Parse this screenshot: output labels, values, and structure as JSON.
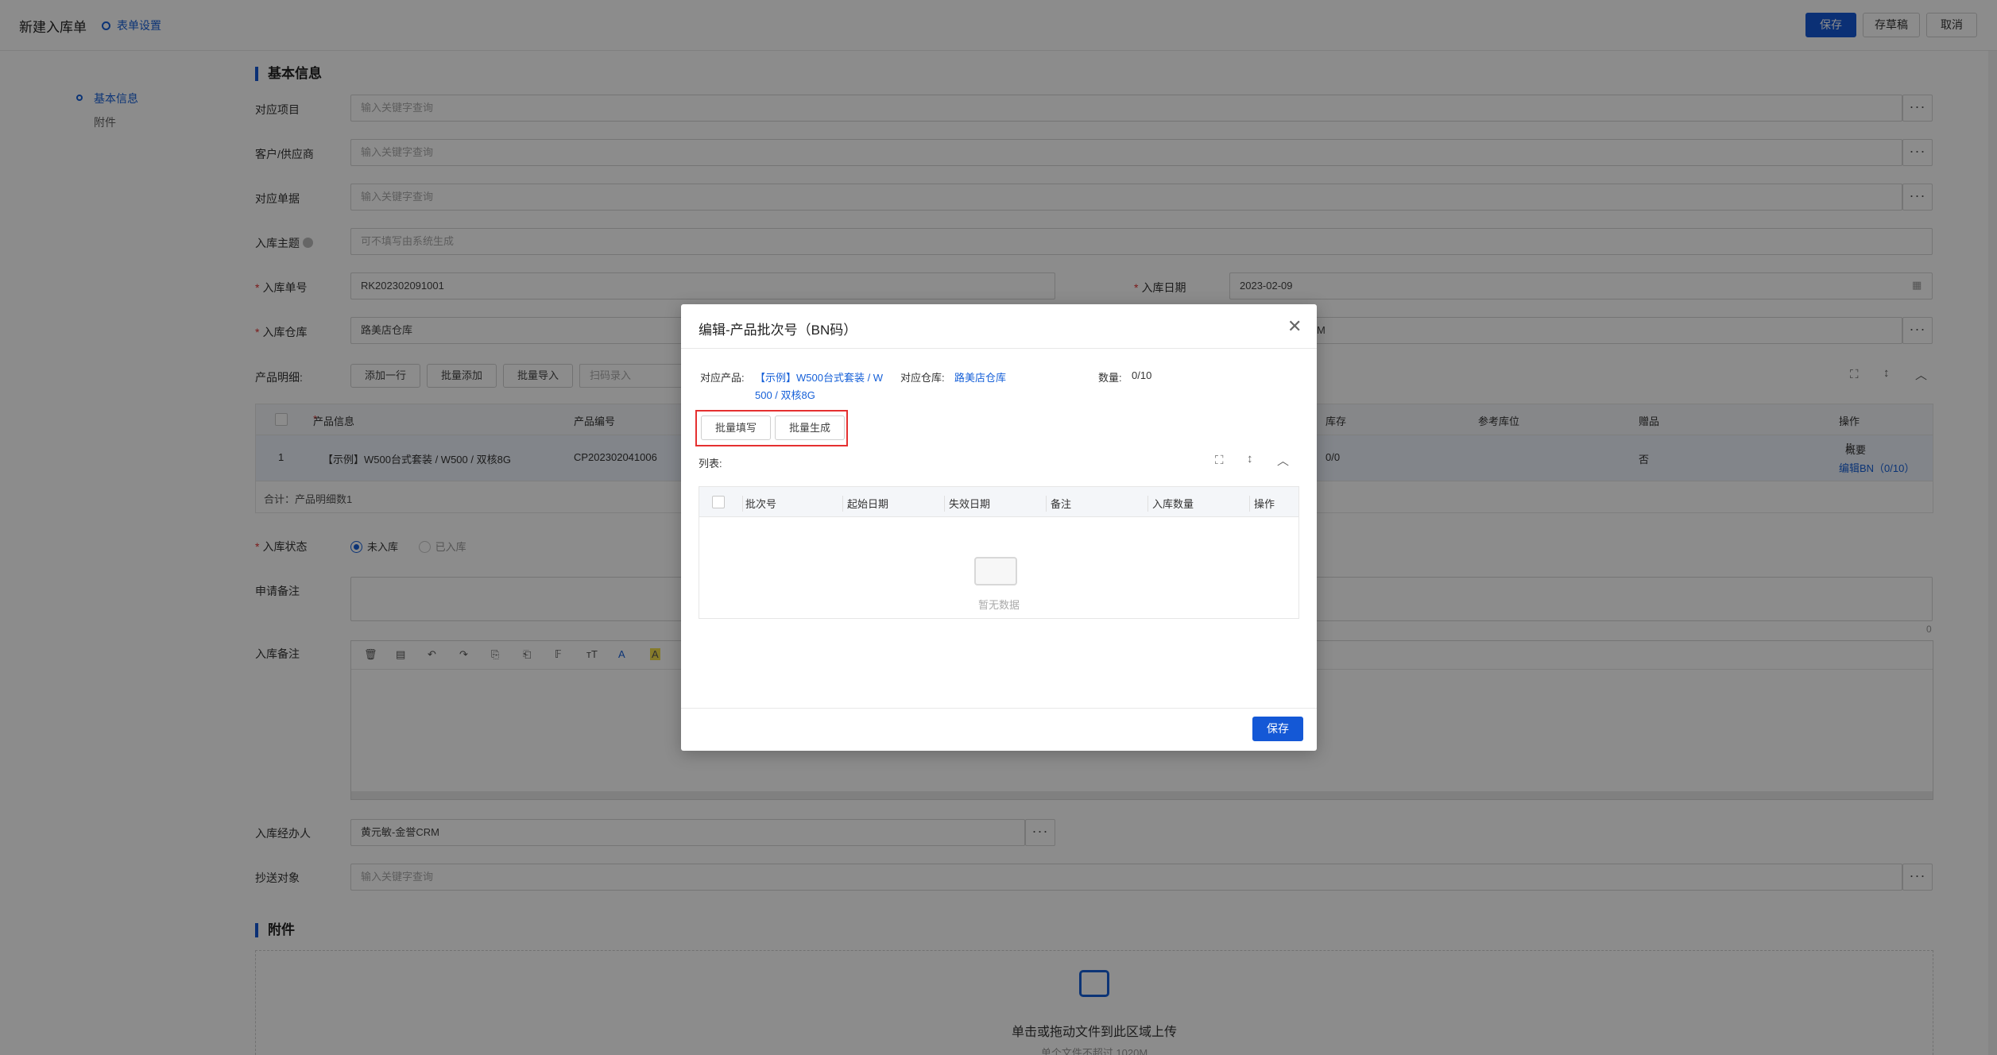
{
  "header": {
    "title": "新建入库单",
    "settings_label": "表单设置",
    "save_label": "保存",
    "draft_label": "存草稿",
    "cancel_label": "取消"
  },
  "sidenav": {
    "items": [
      {
        "label": "基本信息",
        "active": true
      },
      {
        "label": "附件",
        "active": false
      }
    ]
  },
  "form": {
    "section_basic": "基本信息",
    "fields": {
      "project": {
        "label": "对应项目",
        "placeholder": "输入关键字查询"
      },
      "customer": {
        "label": "客户/供应商",
        "placeholder": "输入关键字查询"
      },
      "document": {
        "label": "对应单据",
        "placeholder": "输入关键字查询"
      },
      "subject": {
        "label": "入库主题",
        "placeholder": "可不填写由系统生成"
      },
      "order_no": {
        "label": "入库单号",
        "value": "RK202302091001"
      },
      "date": {
        "label": "入库日期",
        "value": "2023-02-09"
      },
      "warehouse": {
        "label": "入库仓库",
        "value": "路美店仓库"
      },
      "warehouse_right_fragment": "M",
      "status": {
        "label": "入库状态",
        "options": [
          "未入库",
          "已入库"
        ],
        "selected": "未入库"
      },
      "apply_note": {
        "label": "申请备注",
        "counter": "0"
      },
      "stock_note": {
        "label": "入库备注"
      },
      "handler": {
        "label": "入库经办人",
        "value": "黄元敏-金誉CRM"
      },
      "cc": {
        "label": "抄送对象",
        "placeholder": "输入关键字查询"
      }
    },
    "products": {
      "label": "产品明细:",
      "add_row": "添加一行",
      "batch_add": "批量添加",
      "batch_import": "批量导入",
      "scan_placeholder": "扫码录入",
      "columns": [
        "产品信息",
        "产品编号",
        "库存",
        "参考库位",
        "赠品",
        "操作"
      ],
      "rows": [
        {
          "index": "1",
          "info": "【示例】W500台式套装 / W500 / 双核8G",
          "code": "CP202302041006",
          "stock": "0/0",
          "gift": "否",
          "op_summary": "概要",
          "op_edit": "编辑BN（0/10）"
        }
      ],
      "summary": "合计：产品明细数1"
    },
    "section_attach": "附件",
    "upload_text": "单击或拖动文件到此区域上传",
    "upload_hint": "单个文件不超过 1020M"
  },
  "modal": {
    "title": "编辑-产品批次号（BN码）",
    "product_label": "对应产品:",
    "product_value_line1": "【示例】W500台式套装 / W",
    "product_value_line2": "500 / 双核8G",
    "warehouse_label": "对应仓库:",
    "warehouse_value": "路美店仓库",
    "qty_label": "数量:",
    "qty_value": "0/10",
    "batch_fill": "批量填写",
    "batch_generate": "批量生成",
    "list_label": "列表:",
    "columns": [
      "批次号",
      "起始日期",
      "失效日期",
      "备注",
      "入库数量",
      "操作"
    ],
    "empty_text": "暂无数据",
    "save_label": "保存"
  },
  "colors": {
    "primary": "#1458d6",
    "link": "#1660d8",
    "highlight_border": "#e53030"
  }
}
